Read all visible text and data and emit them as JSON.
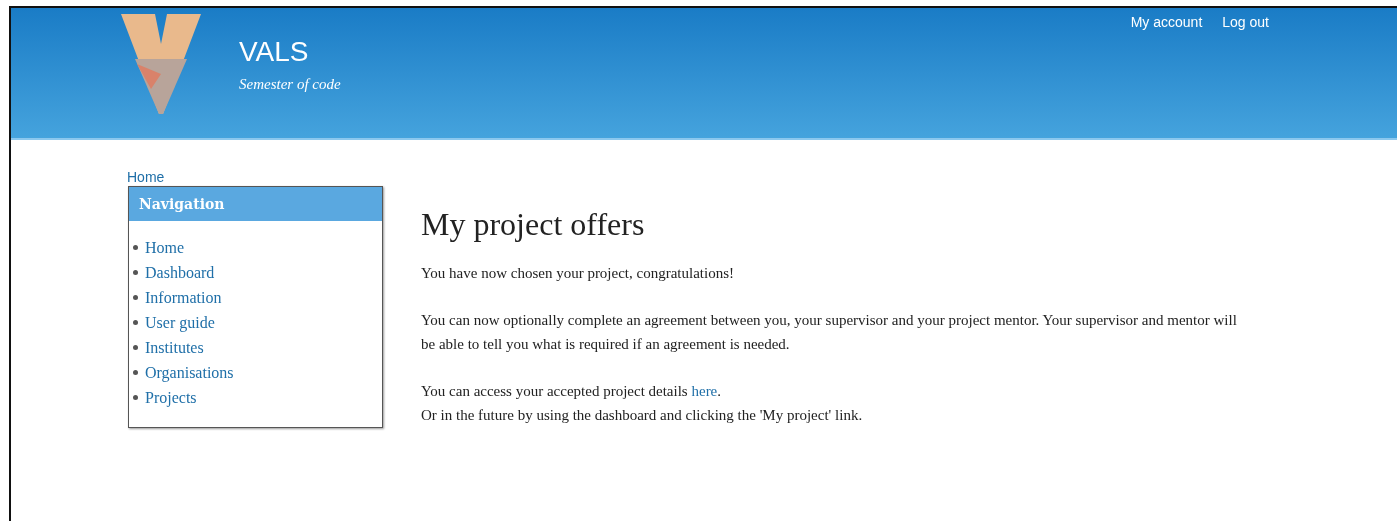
{
  "header": {
    "site_name": "VALS",
    "slogan": "Semester of code",
    "links": [
      {
        "label": "My account"
      },
      {
        "label": "Log out"
      }
    ]
  },
  "breadcrumb": "Home",
  "navigation": {
    "title": "Navigation",
    "items": [
      {
        "label": "Home"
      },
      {
        "label": "Dashboard"
      },
      {
        "label": "Information"
      },
      {
        "label": "User guide"
      },
      {
        "label": "Institutes"
      },
      {
        "label": "Organisations"
      },
      {
        "label": "Projects"
      }
    ]
  },
  "content": {
    "heading": "My project offers",
    "paragraphs": [
      {
        "lines": [
          {
            "text": "You have now chosen your project, congratulations!"
          }
        ]
      },
      {
        "lines": [
          {
            "text": "You can now optionally complete an agreement between you, your supervisor and your project mentor. Your supervisor and mentor will be able to tell you what is required if an agreement is needed."
          }
        ]
      },
      {
        "lines": [
          {
            "text": "You can access your accepted project details ",
            "link": "here",
            "after": "."
          },
          {
            "text": "Or in the future by using the dashboard and clicking the 'My project' link."
          }
        ]
      }
    ]
  }
}
